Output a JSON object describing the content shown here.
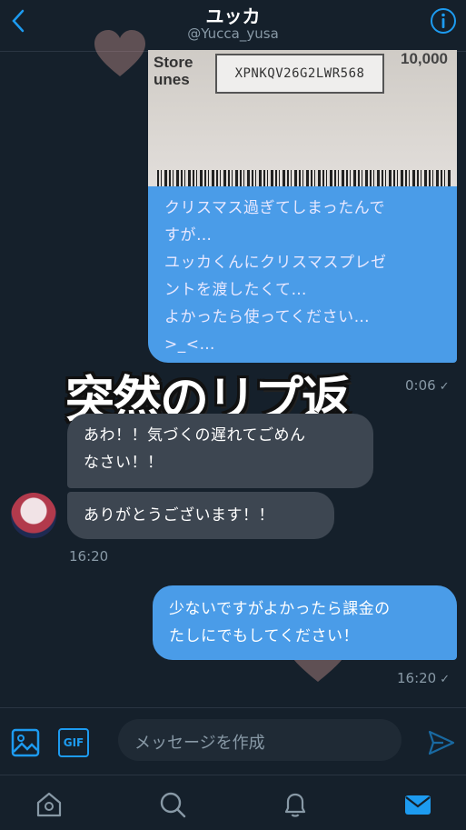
{
  "header": {
    "title": "ユッカ",
    "handle": "@Yucca_yusa"
  },
  "media": {
    "card_text": "Store\nunes",
    "code": "XPNKQV26G2LWR568",
    "value": "10,000"
  },
  "messages": {
    "outgoing_1": "クリスマス過ぎてしまったんで\nすが…\nユッカくんにクリスマスプレゼ\nントを渡したくて…\nよかったら使ってください…\n>_<…",
    "outgoing_1_time": "0:06",
    "incoming_1": "あわ！！気づくの遅れてごめん\nなさい！！",
    "incoming_2": "ありがとうございます！！",
    "incoming_time": "16:20",
    "outgoing_2": "少ないですがよかったら課金の\nたしにでもしてください！",
    "outgoing_2_time": "16:20"
  },
  "overlay": {
    "text": "突然のリプ返"
  },
  "composer": {
    "placeholder": "メッセージを作成",
    "gif_label": "GIF"
  },
  "colors": {
    "background": "#15202b",
    "accent": "#1d9bf0",
    "outgoing_bubble": "#4a9ce8",
    "incoming_bubble": "#3d4651"
  }
}
